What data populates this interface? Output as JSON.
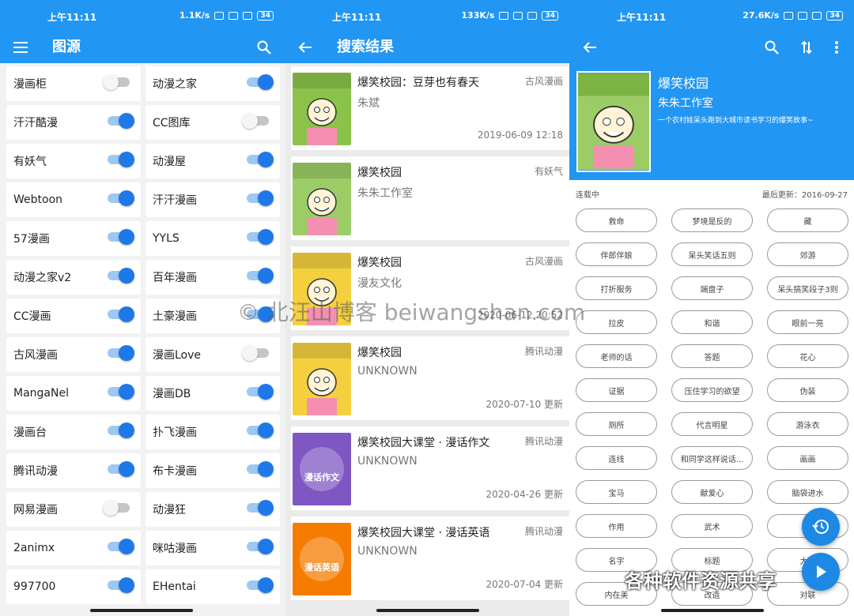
{
  "status_bars": [
    {
      "time": "上午11:11",
      "speed": "1.1K/s",
      "battery": "34"
    },
    {
      "time": "上午11:11",
      "speed": "133K/s",
      "battery": "34"
    },
    {
      "time": "上午11:11",
      "speed": "27.6K/s",
      "battery": "34"
    }
  ],
  "sources_screen": {
    "title": "图源",
    "left_column": [
      {
        "name": "漫画柜",
        "enabled": false
      },
      {
        "name": "汗汗酷漫",
        "enabled": true
      },
      {
        "name": "有妖气",
        "enabled": true
      },
      {
        "name": "Webtoon",
        "enabled": true
      },
      {
        "name": "57漫画",
        "enabled": true
      },
      {
        "name": "动漫之家v2",
        "enabled": true
      },
      {
        "name": "CC漫画",
        "enabled": true
      },
      {
        "name": "古风漫画",
        "enabled": true
      },
      {
        "name": "MangaNel",
        "enabled": true
      },
      {
        "name": "漫画台",
        "enabled": true
      },
      {
        "name": "腾讯动漫",
        "enabled": true
      },
      {
        "name": "网易漫画",
        "enabled": false
      },
      {
        "name": "2animx",
        "enabled": true
      },
      {
        "name": "997700",
        "enabled": true
      }
    ],
    "right_column": [
      {
        "name": "动漫之家",
        "enabled": true
      },
      {
        "name": "CC图库",
        "enabled": false
      },
      {
        "name": "动漫屋",
        "enabled": true
      },
      {
        "name": "汗汗漫画",
        "enabled": true
      },
      {
        "name": "YYLS",
        "enabled": true
      },
      {
        "name": "百年漫画",
        "enabled": true
      },
      {
        "name": "土豪漫画",
        "enabled": true
      },
      {
        "name": "漫画Love",
        "enabled": false
      },
      {
        "name": "漫画DB",
        "enabled": true
      },
      {
        "name": "扑飞漫画",
        "enabled": true
      },
      {
        "name": "布卡漫画",
        "enabled": true
      },
      {
        "name": "动漫狂",
        "enabled": true
      },
      {
        "name": "咪咕漫画",
        "enabled": true
      },
      {
        "name": "EHentai",
        "enabled": true
      }
    ]
  },
  "search_screen": {
    "title": "搜索结果",
    "results": [
      {
        "title": "爆笑校园：豆芽也有春天",
        "author": "朱斌",
        "source": "古风漫画",
        "date": "2019-06-09 12:18",
        "cover_color": "#8bc34a"
      },
      {
        "title": "爆笑校园",
        "author": "朱朱工作室",
        "source": "有妖气",
        "date": "",
        "cover_color": "#9ccc65"
      },
      {
        "title": "爆笑校园",
        "author": "漫友文化",
        "source": "古风漫画",
        "date": "2020-06-12 20:52",
        "cover_color": "#f4d03f"
      },
      {
        "title": "爆笑校园",
        "author": "UNKNOWN",
        "source": "腾讯动漫",
        "date": "2020-07-10 更新",
        "cover_color": "#f4d03f"
      },
      {
        "title": "爆笑校园大课堂 · 漫话作文",
        "author": "UNKNOWN",
        "source": "腾讯动漫",
        "date": "2020-04-26 更新",
        "cover_color": "#7e57c2",
        "cover_text": "漫话作文"
      },
      {
        "title": "爆笑校园大课堂 · 漫话英语",
        "author": "UNKNOWN",
        "source": "腾讯动漫",
        "date": "2020-07-04 更新",
        "cover_color": "#f57c00",
        "cover_text": "漫话英语"
      }
    ]
  },
  "detail_screen": {
    "book_title": "爆笑校园",
    "author": "朱朱工作室",
    "description": "一个农村娃呆头跑到大城市读书学习的爆笑故事~",
    "status": "连载中",
    "last_update": "最后更新：2016-09-27",
    "chapters": [
      "救命",
      "梦境是反的",
      "藏",
      "伴郎伴娘",
      "呆头笑话五则",
      "郊游",
      "打折服务",
      "端盘子",
      "呆头搞笑段子3则",
      "拉皮",
      "和谐",
      "眼前一亮",
      "老师的话",
      "答题",
      "花心",
      "证据",
      "压住学习的欲望",
      "伪装",
      "厕所",
      "代言明星",
      "游泳衣",
      "连线",
      "和同学这样说话...",
      "画画",
      "宝马",
      "献爱心",
      "脑袋进水",
      "作用",
      "武术",
      "作",
      "名字",
      "标题",
      "大海",
      "内在美",
      "改造",
      "对联"
    ]
  },
  "overlays": {
    "watermark": "© 北汪山博客 beiwangshan.com",
    "wechat_caption": "各种软件资源共享"
  },
  "colors": {
    "primary": "#2196f3",
    "toggle_on": "#1e78e8",
    "fab": "#1e88e5"
  }
}
